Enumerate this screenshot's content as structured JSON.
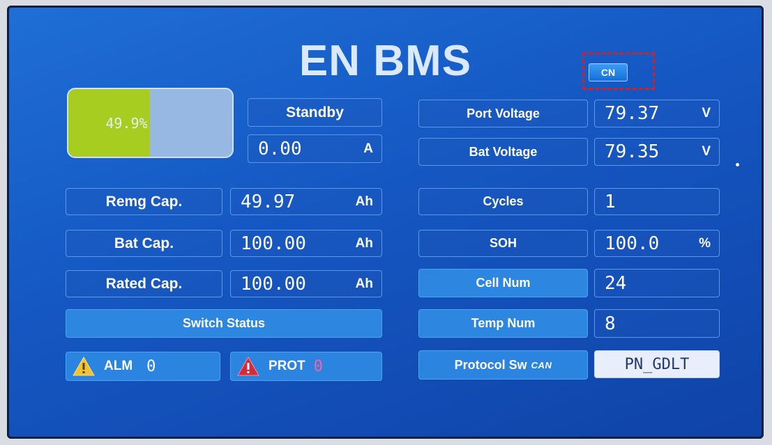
{
  "title": "EN BMS",
  "lang_button": "CN",
  "battery": {
    "text": "49.9%",
    "level": 0.499
  },
  "status": "Standby",
  "current": {
    "value": "0.00",
    "unit": "A"
  },
  "left_rows": [
    {
      "label": "Remg Cap.",
      "value": "49.97",
      "unit": "Ah"
    },
    {
      "label": "Bat Cap.",
      "value": "100.00",
      "unit": "Ah"
    },
    {
      "label": "Rated Cap.",
      "value": "100.00",
      "unit": "Ah"
    }
  ],
  "switch_status": "Switch Status",
  "alarm": {
    "label": "ALM",
    "count": "0",
    "count_color": "#ffffff"
  },
  "protection": {
    "label": "PROT",
    "count": "0",
    "count_color": "#ff5fa8"
  },
  "right_rows": [
    {
      "label": "Port Voltage",
      "value": "79.37",
      "unit": "V"
    },
    {
      "label": "Bat Voltage",
      "value": "79.35",
      "unit": "V"
    },
    {
      "label": "Cycles",
      "value": "1",
      "unit": ""
    },
    {
      "label": "SOH",
      "value": "100.0",
      "unit": "%"
    },
    {
      "label": "Cell Num",
      "value": "24",
      "unit": ""
    },
    {
      "label": "Temp Num",
      "value": "8",
      "unit": ""
    }
  ],
  "protocol": {
    "label": "Protocol Sw",
    "tag": "CAN",
    "value": "PN_GDLT"
  },
  "colors": {
    "battery_fill": "#a6cd20",
    "screen_bg": "#1557c2",
    "highlight": "#d42020"
  }
}
